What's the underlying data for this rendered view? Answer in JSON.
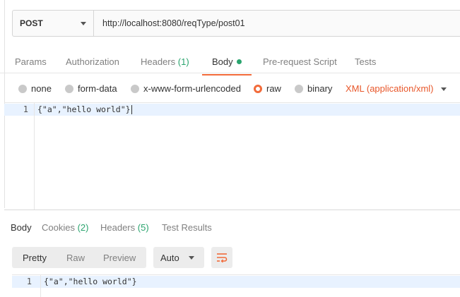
{
  "request": {
    "method": "POST",
    "url": "http://localhost:8080/reqType/post01"
  },
  "request_tabs": [
    {
      "label": "Params"
    },
    {
      "label": "Authorization"
    },
    {
      "label": "Headers",
      "count": "(1)"
    },
    {
      "label": "Body",
      "active": true
    },
    {
      "label": "Pre-request Script"
    },
    {
      "label": "Tests"
    }
  ],
  "body_types": [
    {
      "label": "none"
    },
    {
      "label": "form-data"
    },
    {
      "label": "x-www-form-urlencoded"
    },
    {
      "label": "raw",
      "selected": true
    },
    {
      "label": "binary"
    }
  ],
  "content_type": "XML (application/xml)",
  "request_editor": {
    "line_number": "1",
    "code": "{\"a\",\"hello world\"}"
  },
  "response_tabs": [
    {
      "label": "Body",
      "active": true
    },
    {
      "label": "Cookies",
      "count": "(2)"
    },
    {
      "label": "Headers",
      "count": "(5)"
    },
    {
      "label": "Test Results"
    }
  ],
  "response_view": {
    "modes": [
      "Pretty",
      "Raw",
      "Preview"
    ],
    "active_mode": "Pretty",
    "format": "Auto"
  },
  "response_editor": {
    "line_number": "1",
    "code": "{\"a\",\"hello world\"}"
  },
  "colors": {
    "accent": "#f26b3a",
    "content_type": "#e8572a",
    "count_green": "#2aa46e",
    "line_highlight": "#e8f2ff"
  },
  "icons": {
    "wrap_toggle": "wrap-lines-icon",
    "method_dropdown": "chevron-down-icon"
  }
}
